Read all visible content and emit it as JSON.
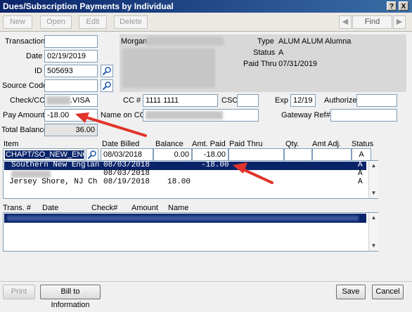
{
  "window": {
    "title": "Dues/Subscription Payments by Individual",
    "help": "?",
    "close": "X"
  },
  "toolbar": {
    "new": "New",
    "open": "Open",
    "edit": "Edit",
    "delete": "Delete",
    "find": "Find",
    "prev": "◀",
    "next": "▶"
  },
  "form": {
    "transaction_label": "Transaction",
    "transaction_value": "",
    "date_label": "Date",
    "date_value": "02/19/2019",
    "id_label": "ID",
    "id_value": "505693",
    "source_code_label": "Source Code",
    "source_code_value": "",
    "check_label": "Check/CC",
    "check_value": ".VISA",
    "cc_label": "CC #",
    "cc_value": "1111 1111",
    "csc_label": "CSC",
    "csc_value": "",
    "exp_label": "Exp",
    "exp_value": "12/19",
    "authorize_label": "Authorize",
    "authorize_value": "",
    "pay_amount_label": "Pay Amount",
    "pay_amount_value": "-18.00",
    "name_on_cc_label": "Name on CC",
    "gateway_label": "Gateway Ref#",
    "gateway_value": "",
    "total_balance_label": "Total Balance",
    "total_balance_value": "36.00"
  },
  "info": {
    "name": "Morgan",
    "type_label": "Type",
    "type_value": "ALUM  ALUM Alumna",
    "status_label": "Status",
    "status_value": "A",
    "paid_thru_label": "Paid Thru",
    "paid_thru_value": "07/31/2019"
  },
  "items": {
    "headers": [
      "Item",
      "Date Billed",
      "Balance",
      "Amt. Paid",
      "Paid Thru",
      "Qty.",
      "Amt Adj.",
      "Status"
    ],
    "edit_row": {
      "item": "CHAPT/SO_NEW_ENG",
      "date_billed": "08/03/2018",
      "balance": "0.00",
      "amt_paid": "-18.00",
      "status": "A"
    },
    "rows": [
      {
        "item": "Southern New Englan",
        "date": "08/03/2018",
        "balance": "",
        "paid": "-18.00",
        "status": "A"
      },
      {
        "item": "",
        "date": "08/03/2018",
        "balance": "",
        "paid": "",
        "status": "A"
      },
      {
        "item": "Jersey Shore, NJ Ch",
        "date": "08/19/2018",
        "balance": "18.00",
        "paid": "",
        "status": "A"
      }
    ]
  },
  "transactions": {
    "headers": [
      "Trans. #",
      "Date",
      "Check#",
      "Amount",
      "Name"
    ]
  },
  "footer": {
    "print": "Print",
    "bill_to": "Bill to Information",
    "save": "Save",
    "cancel": "Cancel"
  },
  "colors": {
    "title_bar": "#0a246a",
    "selection": "#0a246a",
    "annotation_arrow": "#e0342a"
  }
}
